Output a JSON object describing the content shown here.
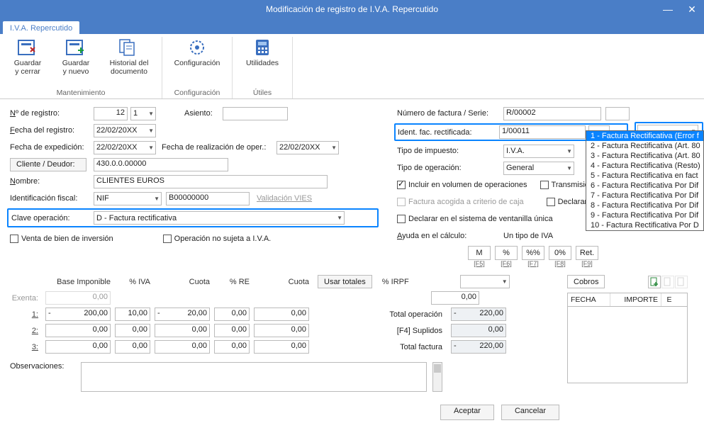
{
  "title": "Modificación de registro de I.V.A. Repercutido",
  "tab": "I.V.A. Repercutido",
  "ribbon": {
    "save_close": "Guardar\ny cerrar",
    "save_new": "Guardar\ny nuevo",
    "history": "Historial del\ndocumento",
    "config": "Configuración",
    "utils": "Utilidades",
    "g1": "Mantenimiento",
    "g2": "Configuración",
    "g3": "Útiles"
  },
  "left": {
    "nreg_lbl": "Nº de registro:",
    "nreg": "12",
    "nreg_page": "1",
    "asiento_lbl": "Asiento:",
    "asiento": "",
    "freg_lbl": "Fecha del registro:",
    "freg": "22/02/20XX",
    "fexp_lbl": "Fecha de expedición:",
    "fexp": "22/02/20XX",
    "foper_lbl": "Fecha de realización de oper.:",
    "foper": "22/02/20XX",
    "cliente_btn": "Cliente / Deudor:",
    "cliente": "430.0.0.00000",
    "nombre_lbl": "Nombre:",
    "nombre": "CLIENTES EUROS",
    "idfisc_lbl": "Identificación fiscal:",
    "idfisc_tipo": "NIF",
    "idfisc_num": "B00000000",
    "vies_lbl": "Validación VIES",
    "clave_lbl": "Clave operación:",
    "clave": "D - Factura rectificativa",
    "venta_lbl": "Venta de bien de inversión",
    "nosujeta_lbl": "Operación no sujeta a I.V.A."
  },
  "right": {
    "nfact_lbl": "Número de factura / Serie:",
    "nfact": "R/00002",
    "idrect_lbl": "Ident. fac. rectificada:",
    "idrect": "1/00011",
    "tipoimp_lbl": "Tipo de impuesto:",
    "tipoimp": "I.V.A.",
    "tipoop_lbl": "Tipo de operación:",
    "tipoop": "General",
    "volop_lbl": "Incluir en volumen de operaciones",
    "transm_lbl": "Transmisión de",
    "caja_lbl": "Factura acogida a criterio de caja",
    "declsub_lbl": "Declarar en su",
    "decl_vu_lbl": "Declarar en el sistema de ventanilla única",
    "ayuda_lbl": "Ayuda en el cálculo:",
    "ayuda": "Un tipo de IVA",
    "btn_M": "M",
    "btn_pct": "%",
    "btn_pctpct": "%%",
    "btn_0pct": "0%",
    "btn_ret": "Ret.",
    "f5": "[F5]",
    "f6": "[F6]",
    "f7": "[F7]",
    "f8": "[F8]",
    "f9": "[F9]"
  },
  "dropdown": {
    "items": [
      "1 - Factura Rectificativa (Error f",
      "2 - Factura Rectificativa (Art. 80",
      "3 - Factura Rectificativa (Art. 80",
      "4 - Factura Rectificativa (Resto)",
      "5 - Factura Rectificativa en fact",
      "6 - Factura Rectificativa Por Dif",
      "7 - Factura Rectificativa Por Dif",
      "8 - Factura Rectificativa Por Dif",
      "9 - Factura Rectificativa Por Dif",
      "10 - Factura Rectificativa Por D"
    ]
  },
  "table": {
    "h_base": "Base Imponible",
    "h_iva": "% IVA",
    "h_cuota": "Cuota",
    "h_re": "% RE",
    "h_cuota2": "Cuota",
    "btn_usr": "Usar totales",
    "h_irpf": "% IRPF",
    "exenta_lbl": "Exenta:",
    "exenta": "0,00",
    "rows": [
      {
        "n": "1:",
        "base": "200,00",
        "pi": "10,00",
        "c1": "20,00",
        "pr": "0,00",
        "c2": "0,00",
        "sign": "-"
      },
      {
        "n": "2:",
        "base": "0,00",
        "pi": "0,00",
        "c1": "0,00",
        "pr": "0,00",
        "c2": "0,00",
        "sign": ""
      },
      {
        "n": "3:",
        "base": "0,00",
        "pi": "0,00",
        "c1": "0,00",
        "pr": "0,00",
        "c2": "0,00",
        "sign": ""
      }
    ],
    "irpf_val": "0,00",
    "irpf_sel": "",
    "tot_op_lbl": "Total operación",
    "tot_op_sign": "-",
    "tot_op": "220,00",
    "supl_lbl": "[F4] Suplidos",
    "supl": "0,00",
    "tot_fac_lbl": "Total factura",
    "tot_fac_sign": "-",
    "tot_fac": "220,00",
    "observ_lbl": "Observaciones:"
  },
  "cobros": {
    "title": "Cobros",
    "h1": "FECHA",
    "h2": "IMPORTE",
    "h3": "E"
  },
  "actions": {
    "ok": "Aceptar",
    "cancel": "Cancelar"
  }
}
